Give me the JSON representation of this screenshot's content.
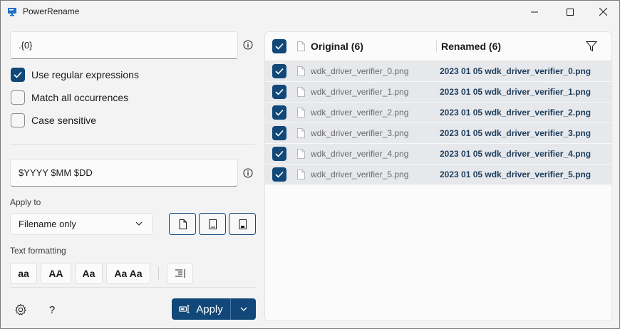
{
  "window": {
    "title": "PowerRename",
    "accent": "#114879"
  },
  "search": {
    "value": ".{0}",
    "info_icon": "info-icon"
  },
  "options": {
    "use_regex": {
      "label": "Use regular expressions",
      "checked": true
    },
    "match_all": {
      "label": "Match all occurrences",
      "checked": false
    },
    "case_sensitive": {
      "label": "Case sensitive",
      "checked": false
    }
  },
  "replace": {
    "value": "$YYYY $MM $DD",
    "info_icon": "info-icon"
  },
  "apply_to": {
    "label": "Apply to",
    "selected": "Filename only",
    "buttons": [
      "include-files-icon",
      "include-folders-icon",
      "include-subfolders-icon"
    ]
  },
  "text_formatting": {
    "label": "Text formatting",
    "buttons": [
      "aa",
      "AA",
      "Aa",
      "Aa Aa"
    ],
    "enumerate_icon": "enumerate-items-icon"
  },
  "footer": {
    "settings_icon": "gear-icon",
    "help_label": "?",
    "apply_label": "Apply"
  },
  "list": {
    "original_header": "Original (6)",
    "renamed_header": "Renamed (6)",
    "rows": [
      {
        "original": "wdk_driver_verifier_0.png",
        "renamed": "2023 01 05 wdk_driver_verifier_0.png"
      },
      {
        "original": "wdk_driver_verifier_1.png",
        "renamed": "2023 01 05 wdk_driver_verifier_1.png"
      },
      {
        "original": "wdk_driver_verifier_2.png",
        "renamed": "2023 01 05 wdk_driver_verifier_2.png"
      },
      {
        "original": "wdk_driver_verifier_3.png",
        "renamed": "2023 01 05 wdk_driver_verifier_3.png"
      },
      {
        "original": "wdk_driver_verifier_4.png",
        "renamed": "2023 01 05 wdk_driver_verifier_4.png"
      },
      {
        "original": "wdk_driver_verifier_5.png",
        "renamed": "2023 01 05 wdk_driver_verifier_5.png"
      }
    ]
  }
}
